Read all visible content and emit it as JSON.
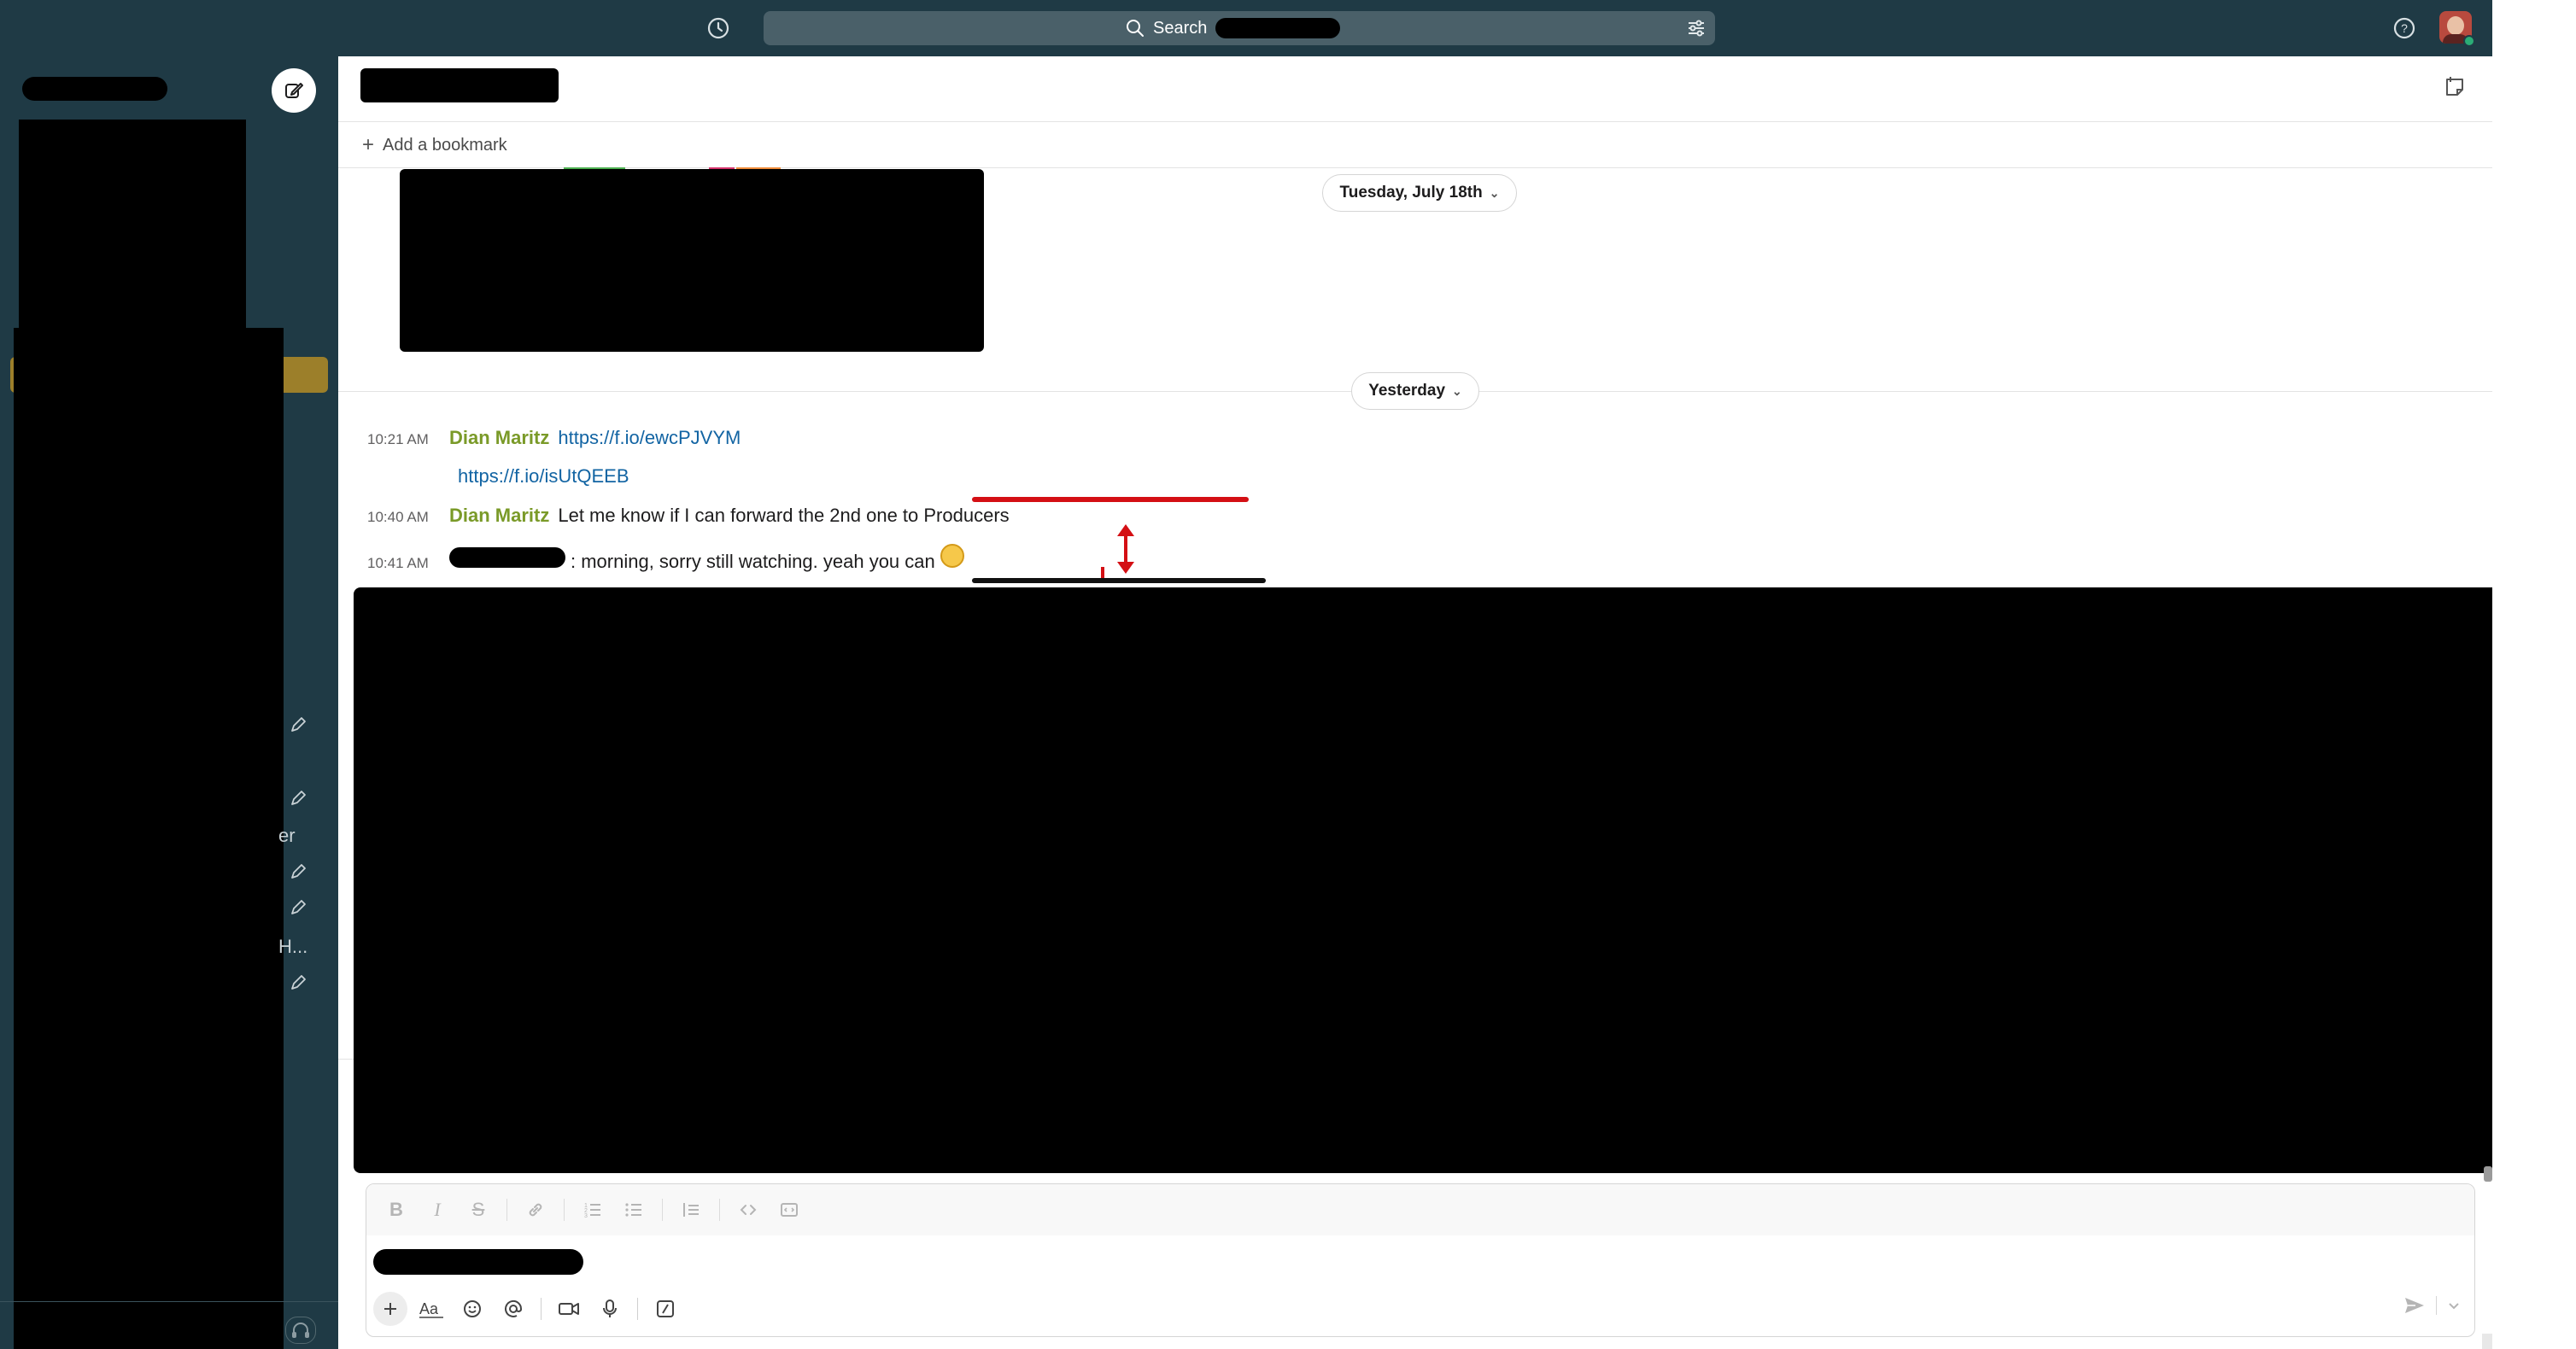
{
  "topbar": {
    "search_label": "Search",
    "history_icon": "clock-history-icon",
    "filter_icon": "sliders-filter-icon",
    "help_icon": "help-circle-icon"
  },
  "sidebar": {
    "visible_text": [
      "er",
      "H..."
    ],
    "accent_color": "#9c7f2a"
  },
  "channel": {
    "add_bookmark_label": "Add a bookmark"
  },
  "dividers": {
    "first": "Tuesday, July 18th",
    "second": "Yesterday"
  },
  "messages": [
    {
      "time": "10:21 AM",
      "author": "Dian Maritz",
      "text": "https://f.io/ewcPJVYM"
    },
    {
      "time": "",
      "author": "",
      "text": "https://f.io/isUtQEEB"
    },
    {
      "time": "10:40 AM",
      "author": "Dian Maritz",
      "text": "Let me know if I can forward the 2nd one to Producers"
    },
    {
      "time": "10:41 AM",
      "author": "",
      "text": ": morning, sorry still watching. yeah you can"
    }
  ],
  "composer": {
    "format_buttons": [
      "B",
      "I",
      "S"
    ]
  },
  "colors": {
    "topbar_bg": "#1f3a45",
    "link": "#1264a3",
    "author": "#7a9a28",
    "annotation_red": "#d40f14"
  }
}
